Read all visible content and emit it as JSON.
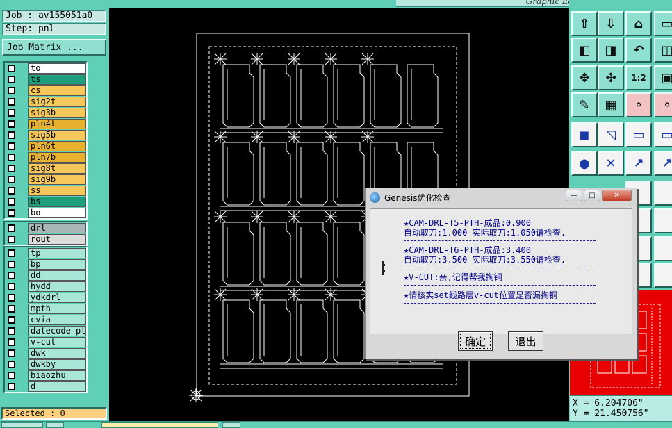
{
  "job_info": {
    "job": "Job : av155051a0",
    "step": "Step: pnl"
  },
  "job_matrix_button": "Job Matrix ...",
  "layers_board": [
    {
      "name": "to",
      "color": "#ffffff"
    },
    {
      "name": "ts",
      "color": "#1f9e7c"
    },
    {
      "name": "cs",
      "color": "#f6c85c"
    },
    {
      "name": "sig2t",
      "color": "#f6c85c"
    },
    {
      "name": "sig3b",
      "color": "#f6c85c"
    },
    {
      "name": "pln4t",
      "color": "#e8b12e"
    },
    {
      "name": "sig5b",
      "color": "#f6c85c"
    },
    {
      "name": "pln6t",
      "color": "#e8b12e"
    },
    {
      "name": "pln7b",
      "color": "#e8b12e"
    },
    {
      "name": "sig8t",
      "color": "#f6c85c"
    },
    {
      "name": "sig9b",
      "color": "#f6c85c"
    },
    {
      "name": "ss",
      "color": "#f6c85c"
    },
    {
      "name": "bs",
      "color": "#1f9e7c"
    },
    {
      "name": "bo",
      "color": "#ffffff"
    }
  ],
  "layers_drill": [
    {
      "name": "drl",
      "color": "#a8b6b8"
    },
    {
      "name": "rout",
      "color": "#dcdcdc"
    }
  ],
  "layers_misc": [
    {
      "name": "tp",
      "color": "#a8e6d8"
    },
    {
      "name": "bp",
      "color": "#a8e6d8"
    },
    {
      "name": "dd",
      "color": "#a8e6d8"
    },
    {
      "name": "hydd",
      "color": "#a8e6d8"
    },
    {
      "name": "ydkdrl",
      "color": "#a8e6d8"
    },
    {
      "name": "mpth",
      "color": "#a8e6d8"
    },
    {
      "name": "cvia",
      "color": "#a8e6d8"
    },
    {
      "name": "datecode-pte",
      "color": "#a8e6d8"
    },
    {
      "name": "v-cut",
      "color": "#a8e6d8"
    },
    {
      "name": "dwk",
      "color": "#a8e6d8"
    },
    {
      "name": "dwkby",
      "color": "#a8e6d8"
    },
    {
      "name": "biaozhu",
      "color": "#a8e6d8"
    },
    {
      "name": "d",
      "color": "#a8e6d8"
    }
  ],
  "status": {
    "selected": "Selected : 0"
  },
  "window": {
    "graphic_editor_title": "Graphic Editor"
  },
  "coords": {
    "x": "X = 6.204706\"",
    "y": "Y = 21.450756\""
  },
  "dialog": {
    "title": "Genesis优化检查",
    "minimize": "—",
    "maximize": "□",
    "close": "✕",
    "msg1_line1": "★CAM-DRL-T5-PTH-成品:0.900",
    "msg1_line2": "自动取刀:1.000 实际取刀:1.050请检查.",
    "msg2_line1": "★CAM-DRL-T6-PTH-成品:3.400",
    "msg2_line2": "自动取刀:3.500 实际取刀:3.550请检查.",
    "msg3": "★V-CUT:亲,记得帮我掏铜",
    "msg4": "★请核实set线路层v-cut位置是否漏掏铜",
    "ok_label": "确定",
    "exit_label": "退出"
  },
  "toolbar_icons": [
    "snapshot-icon",
    "zoom-home-icon",
    "home-icon",
    "panel-icon",
    "pan-left-icon",
    "pan-right-icon",
    "undo-view-icon",
    "view-icon",
    "zoom-fit-icon",
    "zoom-center-icon",
    "scale-1-2-icon",
    "fit-icon",
    "tools-icon",
    "grid-icon",
    "net-icon",
    "net2-icon",
    "pad-icon",
    "select-icon",
    "ruler-icon",
    "ruler2-icon",
    "connect-icon",
    "cross-icon",
    "arrow-icon",
    "arrow2-icon"
  ],
  "colors": {
    "panel": "#5fcfb8",
    "canvas": "#000000",
    "dialog_text": "#00008b",
    "preview": "#e80000"
  }
}
